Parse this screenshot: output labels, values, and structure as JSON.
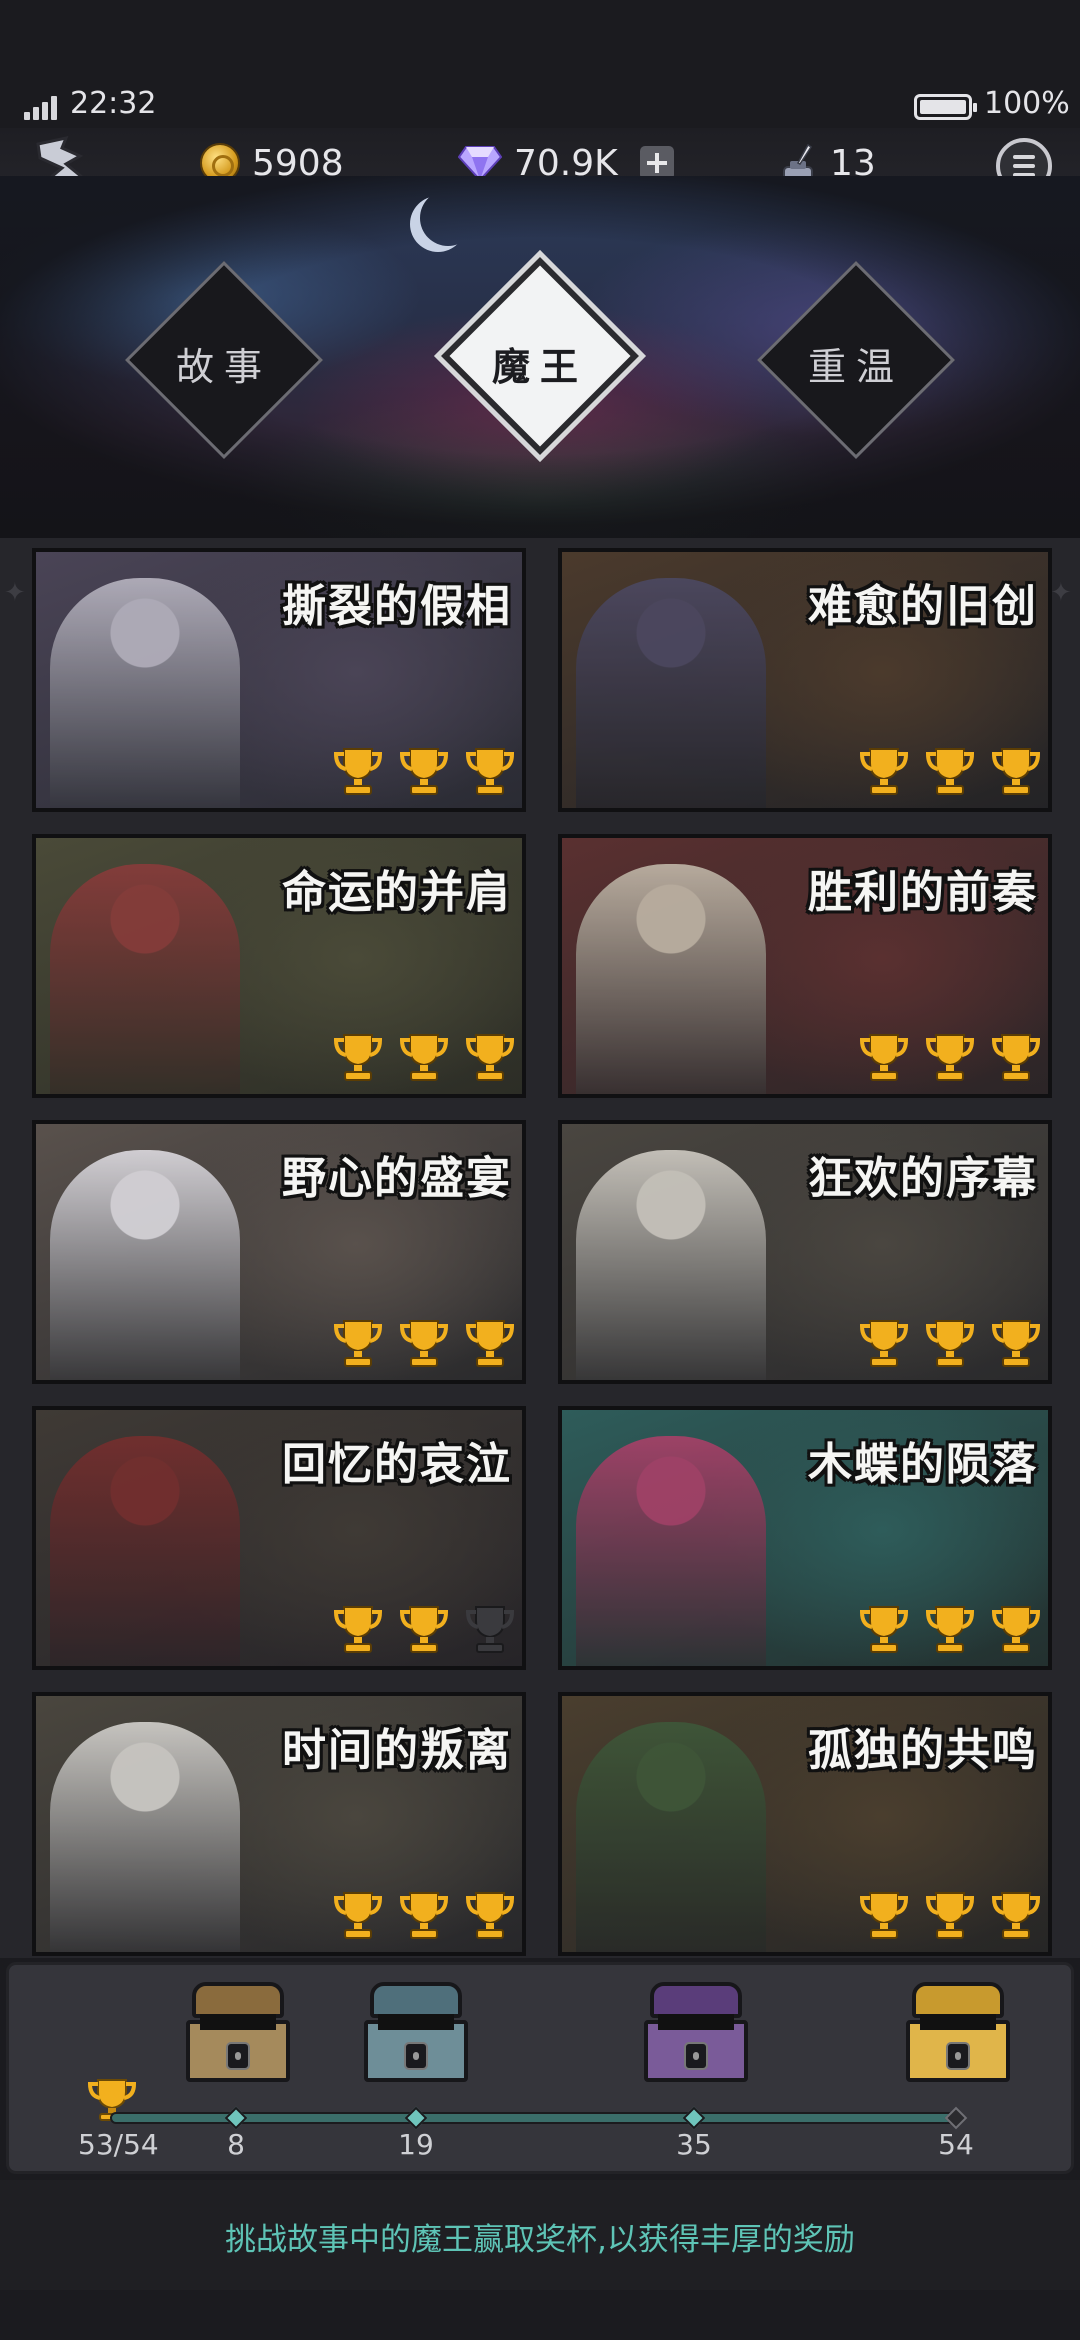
{
  "status_bar": {
    "time": "22:32",
    "battery": "100%",
    "battery_level": 1.0
  },
  "resources": {
    "gold": "5908",
    "gems": "70.9K",
    "ink": "13"
  },
  "mode_tabs": [
    {
      "label": "故事",
      "active": false
    },
    {
      "label": "魔王",
      "active": true
    },
    {
      "label": "重温",
      "active": false
    }
  ],
  "bosses": [
    {
      "title": "撕裂的假相",
      "trophies": 3,
      "earned": 3
    },
    {
      "title": "难愈的旧创",
      "trophies": 3,
      "earned": 3
    },
    {
      "title": "命运的并肩",
      "trophies": 3,
      "earned": 3
    },
    {
      "title": "胜利的前奏",
      "trophies": 3,
      "earned": 3
    },
    {
      "title": "野心的盛宴",
      "trophies": 3,
      "earned": 3
    },
    {
      "title": "狂欢的序幕",
      "trophies": 3,
      "earned": 3
    },
    {
      "title": "回忆的哀泣",
      "trophies": 3,
      "earned": 2
    },
    {
      "title": "木蝶的陨落",
      "trophies": 3,
      "earned": 3
    },
    {
      "title": "时间的叛离",
      "trophies": 3,
      "earned": 3
    },
    {
      "title": "孤独的共鸣",
      "trophies": 3,
      "earned": 3
    }
  ],
  "progress": {
    "score": "53/54",
    "current": 53,
    "max": 54,
    "milestones": [
      "8",
      "19",
      "35",
      "54"
    ]
  },
  "hint": "挑战故事中的魔王赢取奖杯,以获得丰厚的奖励",
  "colors": {
    "accent_teal": "#5ec4b6",
    "trophy_gold": "#f2b01e",
    "trophy_empty": "#3a3a3e"
  }
}
